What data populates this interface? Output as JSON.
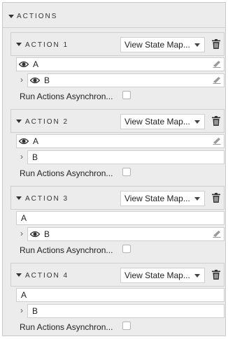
{
  "panel": {
    "title": "ACTIONS"
  },
  "actions": [
    {
      "title": "ACTION 1",
      "select_value": "View State Map...",
      "field_a": {
        "value": "A",
        "eye": true,
        "eraser": true
      },
      "field_b": {
        "value": "B",
        "eye": true,
        "eraser": true
      },
      "run_label": "Run Actions Asynchron...",
      "run_checked": false
    },
    {
      "title": "ACTION 2",
      "select_value": "View State Map...",
      "field_a": {
        "value": "A",
        "eye": true,
        "eraser": true
      },
      "field_b": {
        "value": "B",
        "eye": false,
        "eraser": false
      },
      "run_label": "Run Actions Asynchron...",
      "run_checked": false
    },
    {
      "title": "ACTION 3",
      "select_value": "View State Map...",
      "field_a": {
        "value": "A",
        "eye": false,
        "eraser": false
      },
      "field_b": {
        "value": "B",
        "eye": true,
        "eraser": true
      },
      "run_label": "Run Actions Asynchron...",
      "run_checked": false
    },
    {
      "title": "ACTION 4",
      "select_value": "View State Map...",
      "field_a": {
        "value": "A",
        "eye": false,
        "eraser": false
      },
      "field_b": {
        "value": "B",
        "eye": false,
        "eraser": false
      },
      "run_label": "Run Actions Asynchron...",
      "run_checked": false
    }
  ],
  "icons": {
    "collapse": "caret-down-icon",
    "visibility": "eye-icon",
    "clear": "eraser-icon",
    "delete": "trash-icon",
    "expand": "chevron-right-icon"
  }
}
